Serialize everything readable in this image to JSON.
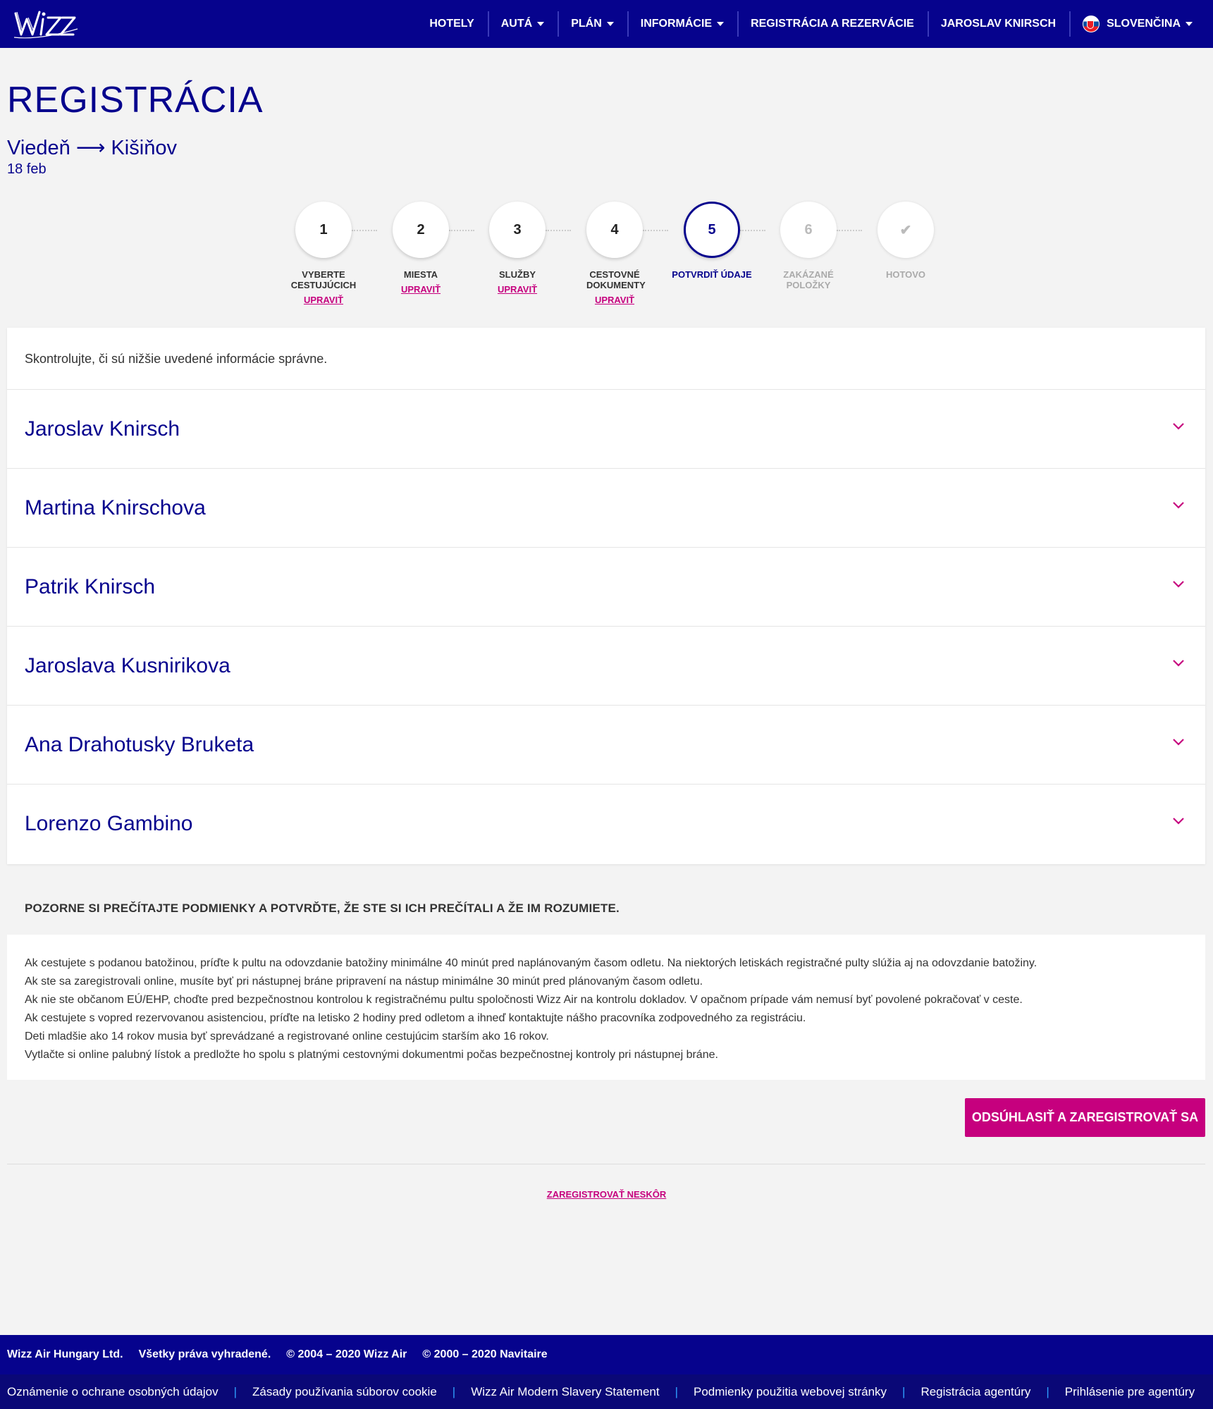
{
  "header": {
    "logo_text": "WIZZ",
    "nav": [
      {
        "label": "Hotely",
        "dropdown": false
      },
      {
        "label": "Autá",
        "dropdown": true
      },
      {
        "label": "Plán",
        "dropdown": true
      },
      {
        "label": "Informácie",
        "dropdown": true
      },
      {
        "label": "Registrácia a rezervácie",
        "dropdown": false
      },
      {
        "label": "Jaroslav Knirsch",
        "dropdown": false
      },
      {
        "label": "Slovenčina",
        "dropdown": true
      }
    ]
  },
  "page": {
    "title": "REGISTRÁCIA",
    "route": "Viedeň ⟶ Kišiňov",
    "date": "18 feb"
  },
  "steps": [
    {
      "number": "1",
      "label": "Vyberte cestujúcich",
      "edit": "Upraviť",
      "state": "done"
    },
    {
      "number": "2",
      "label": "Miesta",
      "edit": "Upraviť",
      "state": "done"
    },
    {
      "number": "3",
      "label": "Služby",
      "edit": "Upraviť",
      "state": "done"
    },
    {
      "number": "4",
      "label": "Cestovné dokumenty",
      "edit": "Upraviť",
      "state": "done"
    },
    {
      "number": "5",
      "label": "Potvrdiť údaje",
      "edit": "",
      "state": "active"
    },
    {
      "number": "6",
      "label": "Zakázané položky",
      "edit": "",
      "state": "disabled"
    },
    {
      "number": "✔",
      "label": "Hotovo",
      "edit": "",
      "state": "disabled"
    }
  ],
  "review": {
    "intro": "Skontrolujte, či sú nižšie uvedené informácie správne.",
    "passengers": [
      "Jaroslav Knirsch",
      "Martina Knirschova",
      "Patrik Knirsch",
      "Jaroslava Kusnirikova",
      "Ana Drahotusky Bruketa",
      "Lorenzo Gambino"
    ]
  },
  "conditions": {
    "title": "POZORNE SI PREČÍTAJTE PODMIENKY A POTVRĎTE, ŽE STE SI ICH PREČÍTALI A ŽE IM ROZUMIETE.",
    "lines": [
      "Ak cestujete s podanou batožinou, príďte k pultu na odovzdanie batožiny minimálne 40 minút pred naplánovaným časom odletu. Na niektorých letiskách registračné pulty slúžia aj na odovzdanie batožiny.",
      "Ak ste sa zaregistrovali online, musíte byť pri nástupnej bráne pripravení na nástup minimálne 30 minút pred plánovaným časom odletu.",
      "Ak nie ste občanom EÚ/EHP, choďte pred bezpečnostnou kontrolou k registračnému pultu spoločnosti Wizz Air na kontrolu dokladov. V opačnom prípade vám nemusí byť povolené pokračovať v ceste.",
      "Ak cestujete s vopred rezervovanou asistenciou, príďte na letisko 2 hodiny pred odletom a ihneď kontaktujte nášho pracovníka zodpovedného za registráciu.",
      "Deti mladšie ako 14 rokov musia byť sprevádzané a registrované online cestujúcim starším ako 16 rokov.",
      "Vytlačte si online palubný lístok a predložte ho spolu s platnými cestovnými dokumentmi počas bezpečnostnej kontroly pri nástupnej bráne."
    ]
  },
  "actions": {
    "confirm": "ODSÚHLASIŤ A ZAREGISTROVAŤ SA",
    "later": "ZAREGISTROVAŤ NESKÔR"
  },
  "footer": {
    "company": "Wizz Air Hungary Ltd.",
    "rights": "Všetky práva vyhradené.",
    "copy1": "© 2004 – 2020 Wizz Air",
    "copy2": "© 2000 – 2020 Navitaire",
    "links": [
      "Oznámenie o ochrane osobných údajov",
      "Zásady používania súborov cookie",
      "Wizz Air Modern Slavery Statement",
      "Podmienky použitia webovej stránky",
      "Registrácia agentúry",
      "Prihlásenie pre agentúry"
    ]
  },
  "colors": {
    "brand_navy": "#06038d",
    "brand_magenta": "#c6007e"
  }
}
